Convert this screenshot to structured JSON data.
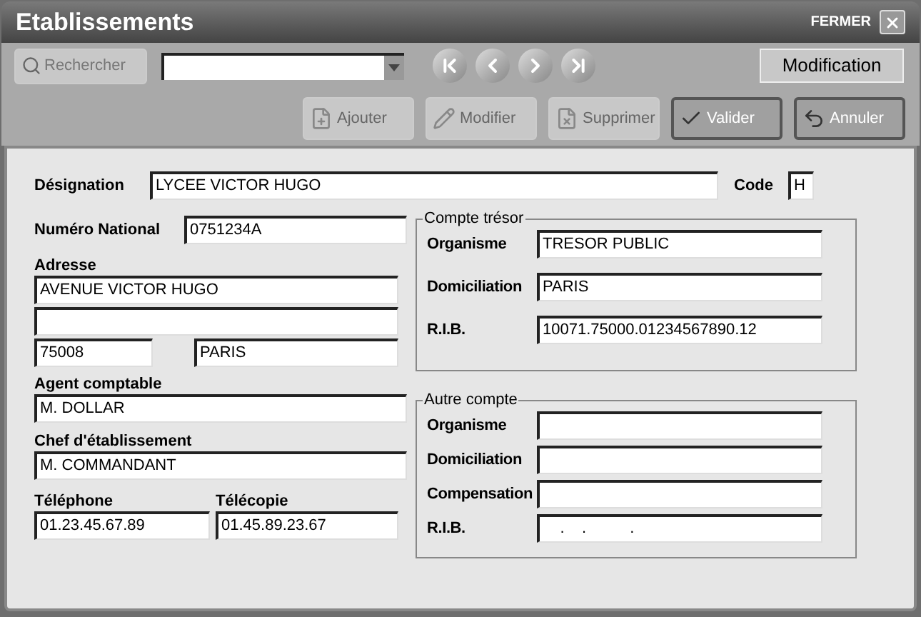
{
  "window": {
    "title": "Etablissements",
    "close_label": "FERMER"
  },
  "toolbar": {
    "search_button": {
      "label": "Rechercher",
      "disabled": true
    },
    "mode": "Modification",
    "nav_buttons": [
      {
        "kind": "first"
      },
      {
        "kind": "previous"
      },
      {
        "kind": "next"
      },
      {
        "kind": "last"
      }
    ],
    "actions": [
      {
        "label": "Ajouter",
        "kind": "add",
        "disabled": true
      },
      {
        "label": "Modifier",
        "kind": "edit",
        "disabled": true
      },
      {
        "label": "Supprimer",
        "kind": "delete",
        "disabled": true
      },
      {
        "label": "Valider",
        "kind": "validate",
        "disabled": false
      },
      {
        "label": "Annuler",
        "kind": "cancel",
        "disabled": false
      }
    ]
  },
  "form": {
    "designation": {
      "label": "Désignation",
      "value": "LYCEE VICTOR HUGO"
    },
    "code": {
      "label": "Code",
      "value": "H"
    },
    "numero_national": {
      "label": "Numéro National",
      "value": "0751234A"
    },
    "adresse": {
      "label": "Adresse",
      "street": "AVENUE VICTOR HUGO",
      "postal_code": "75008",
      "city": "PARIS"
    },
    "agent_comptable": {
      "label": "Agent comptable",
      "value": "M. DOLLAR"
    },
    "chef": {
      "label": "Chef d'établissement",
      "value": "M. COMMANDANT"
    },
    "telephone": {
      "label": "Téléphone",
      "value": "01.23.45.67.89"
    },
    "telecopie": {
      "label": "Télécopie",
      "value": "01.45.89.23.67"
    }
  },
  "compte_tresor": {
    "title": "Compte trésor",
    "fields": [
      {
        "label": "Organisme",
        "value": "TRESOR PUBLIC"
      },
      {
        "label": "Domiciliation",
        "value": "PARIS"
      },
      {
        "label": "R.I.B.",
        "value": "10071.75000.01234567890.12"
      }
    ]
  },
  "autre_compte": {
    "title": "Autre compte",
    "fields": [
      {
        "label": "Organisme"
      },
      {
        "label": "Domiciliation"
      },
      {
        "label": "Compensation"
      },
      {
        "label": "R.I.B.",
        "value": "    .    .          ."
      }
    ]
  }
}
